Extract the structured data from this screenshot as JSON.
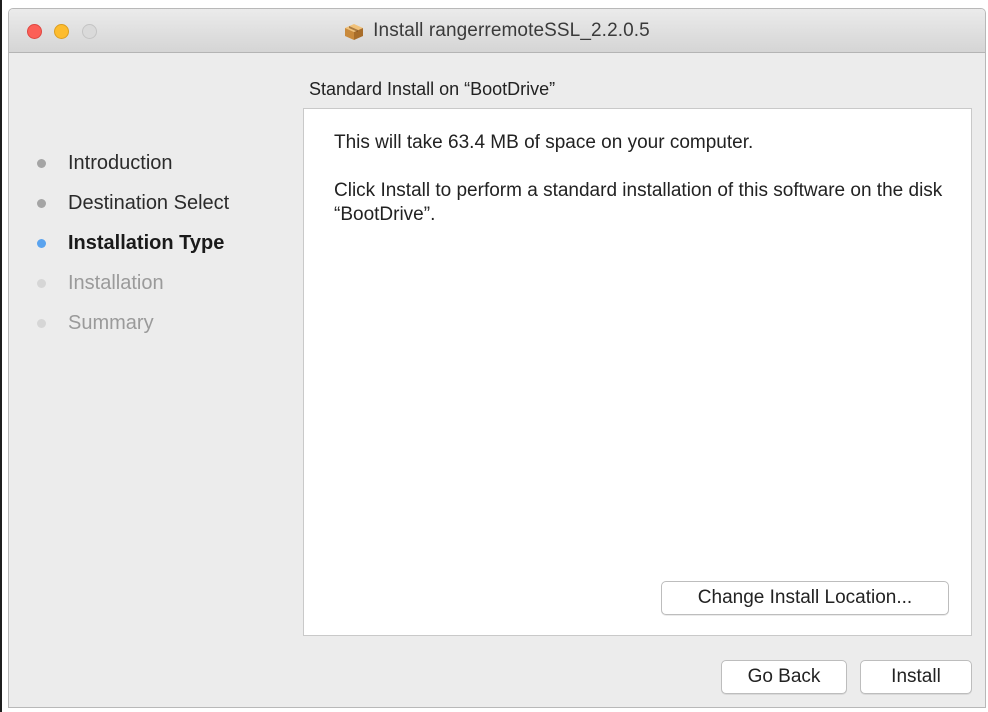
{
  "window": {
    "title": "Install rangerremoteSSL_2.2.0.5",
    "title_icon": "package-icon"
  },
  "sidebar": {
    "steps": [
      {
        "label": "Introduction",
        "state": "done"
      },
      {
        "label": "Destination Select",
        "state": "done"
      },
      {
        "label": "Installation Type",
        "state": "current"
      },
      {
        "label": "Installation",
        "state": "pending"
      },
      {
        "label": "Summary",
        "state": "pending"
      }
    ]
  },
  "main": {
    "pane_title": "Standard Install on “BootDrive”",
    "space_message": "This will take 63.4 MB of space on your computer.",
    "instruction": "Click Install to perform a standard installation of this software on the disk “BootDrive”.",
    "change_location_label": "Change Install Location..."
  },
  "footer": {
    "go_back_label": "Go Back",
    "install_label": "Install"
  },
  "colors": {
    "current_step_dot": "#5aa3ee",
    "close_button": "#fc5f57",
    "minimize_button": "#fdbc2e",
    "zoom_button": "#dadada"
  }
}
